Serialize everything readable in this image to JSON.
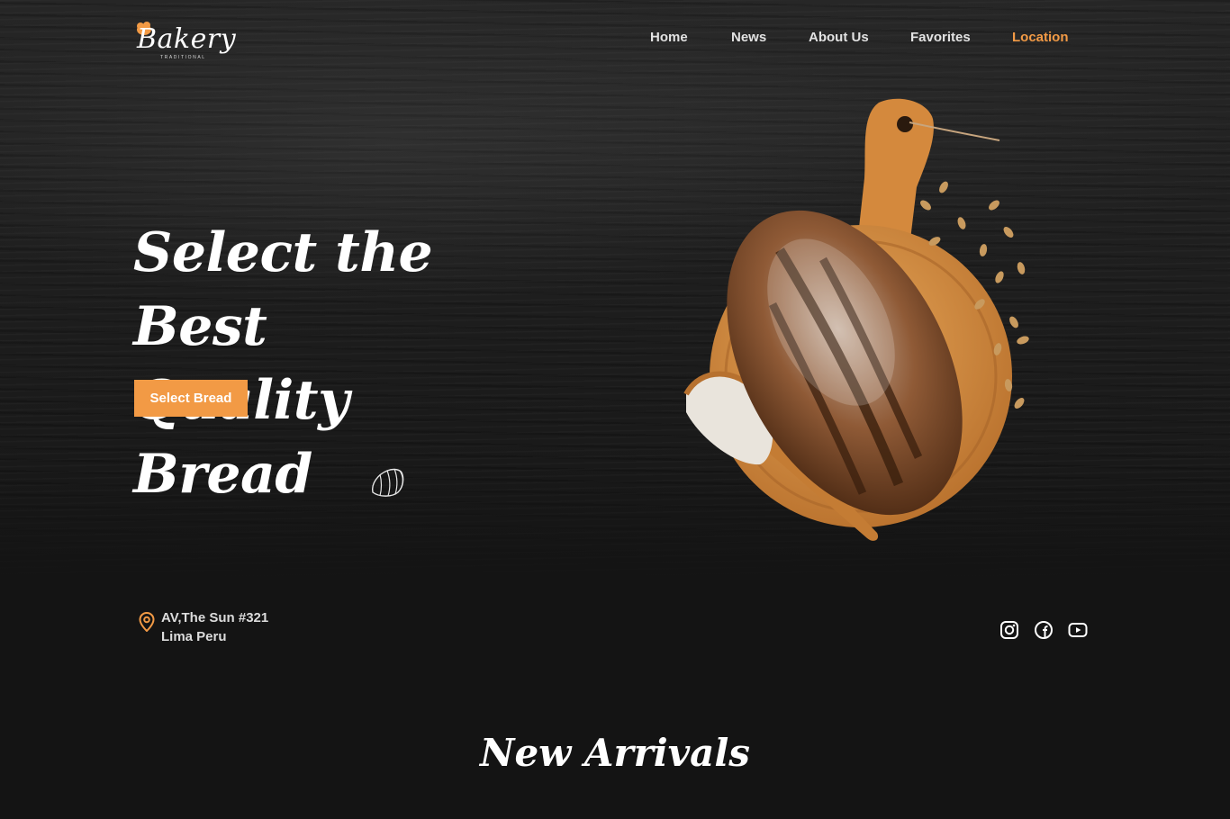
{
  "brand": {
    "name": "Bakery",
    "tagline": "TRADITIONAL",
    "accent_color": "#f29a45"
  },
  "nav": {
    "items": [
      {
        "label": "Home",
        "active": false
      },
      {
        "label": "News",
        "active": false
      },
      {
        "label": "About Us",
        "active": false
      },
      {
        "label": "Favorites",
        "active": false
      },
      {
        "label": "Location",
        "active": true
      }
    ]
  },
  "hero": {
    "headline_line1": "Select the Best",
    "headline_line2": "Quality Bread",
    "cta_label": "Select Bread"
  },
  "address": {
    "icon": "map-pin-icon",
    "line1": "AV,The Sun #321",
    "line2": "Lima Peru"
  },
  "socials": [
    "instagram-icon",
    "facebook-icon",
    "youtube-icon"
  ],
  "new_arrivals": {
    "title": "New Arrivals"
  }
}
